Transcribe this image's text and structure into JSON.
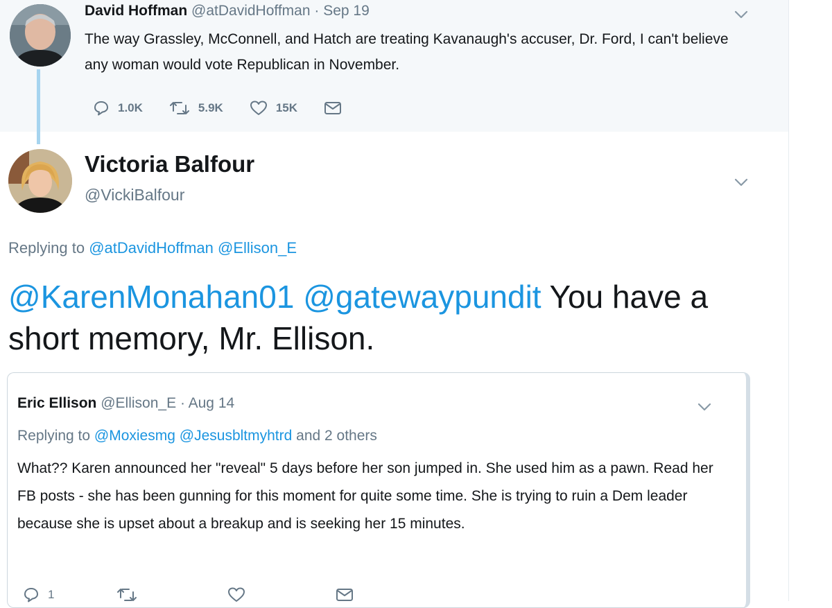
{
  "parent_tweet": {
    "name": "David Hoffman",
    "handle": "@atDavidHoffman",
    "separator": "·",
    "date": "Sep 19",
    "text": "The way Grassley, McConnell, and Hatch are treating Kavanaugh's accuser, Dr. Ford, I can't believe any woman would vote Republican in November.",
    "replies": "1.0K",
    "retweets": "5.9K",
    "likes": "15K"
  },
  "reply_tweet": {
    "name": "Victoria Balfour",
    "handle": "@VickiBalfour",
    "replying_prefix": "Replying to",
    "replying_to": [
      "@atDavidHoffman",
      "@Ellison_E"
    ],
    "mention1": "@KarenMonahan01",
    "mention2": "@gatewaypundit",
    "text": "You have a short memory, Mr. Ellison."
  },
  "quoted_tweet": {
    "name": "Eric Ellison",
    "handle": "@Ellison_E",
    "separator": "·",
    "date": "Aug 14",
    "replying_prefix": "Replying to",
    "replying_to": [
      "@Moxiesmg",
      "@Jesusbltmyhtrd"
    ],
    "replying_suffix": "and 2 others",
    "text": "What?? Karen announced her \"reveal\" 5 days before her son jumped in. She used him as a pawn. Read her FB posts - she has been gunning for this moment for quite some time. She is trying to ruin a Dem leader because she is upset about a breakup and is seeking her 15 minutes.",
    "replies": "1"
  },
  "icons": {
    "reply": "reply-icon",
    "retweet": "retweet-icon",
    "like": "heart-icon",
    "dm": "envelope-icon",
    "menu": "chevron-down-icon"
  },
  "colors": {
    "link": "#1b95e0",
    "muted": "#657786",
    "thread_line": "#a6d4ef",
    "parent_bg": "#f5f8fa"
  }
}
